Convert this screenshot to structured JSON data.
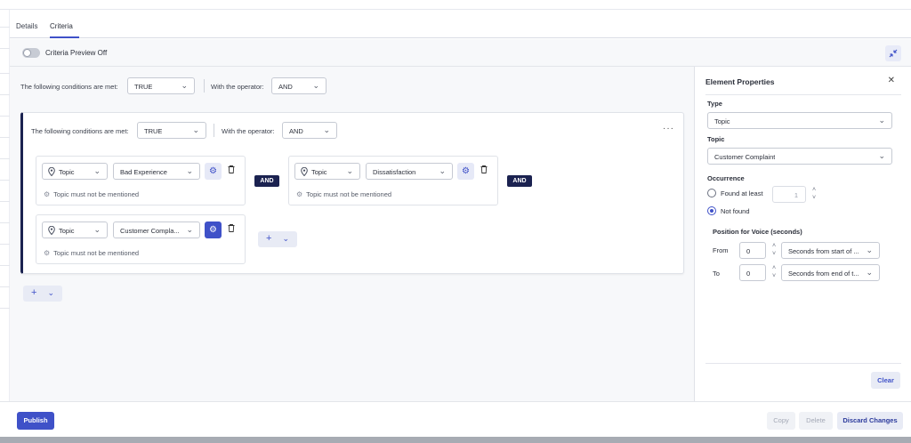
{
  "tabs": [
    {
      "label": "Details",
      "active": false
    },
    {
      "label": "Criteria",
      "active": true
    }
  ],
  "preview": {
    "label": "Criteria Preview Off",
    "on": false
  },
  "icons": {
    "collapse": "collapse-icon",
    "chevron": "chevron-down-icon",
    "pin": "map-pin-icon",
    "gear": "gear-icon",
    "trash": "trash-icon",
    "more": "more-horizontal-icon",
    "close": "close-icon",
    "plus": "plus-icon"
  },
  "root": {
    "conditions_label": "The following conditions are met:",
    "conditions_value": "TRUE",
    "operator_label": "With the operator:",
    "operator_value": "AND"
  },
  "group": {
    "conditions_label": "The following conditions are met:",
    "conditions_value": "TRUE",
    "operator_label": "With the operator:",
    "operator_value": "AND",
    "more": "···",
    "conditions": [
      {
        "type": "Topic",
        "value": "Bad Experience",
        "note": "Topic must not be mentioned",
        "active": false
      },
      {
        "type": "Topic",
        "value": "Dissatisfaction",
        "note": "Topic must not be mentioned",
        "active": false
      },
      {
        "type": "Topic",
        "value": "Customer Compla...",
        "note": "Topic must not be mentioned",
        "active": true
      }
    ],
    "and_label": "AND"
  },
  "add": {
    "plus": "+",
    "chevron": "⌄"
  },
  "panel": {
    "title": "Element Properties",
    "close": "✕",
    "type_label": "Type",
    "type_value": "Topic",
    "topic_label": "Topic",
    "topic_value": "Customer Complaint",
    "occurrence_label": "Occurrence",
    "found_at_least": "Found at least",
    "found_count": "1",
    "not_found": "Not found",
    "selected": "not_found",
    "voice_title": "Position for Voice (seconds)",
    "from_label": "From",
    "from_value": "0",
    "from_ref": "Seconds from start of ...",
    "to_label": "To",
    "to_value": "0",
    "to_ref": "Seconds from end of t...",
    "clear": "Clear"
  },
  "footer": {
    "publish": "Publish",
    "copy": "Copy",
    "delete": "Delete",
    "discard": "Discard Changes"
  },
  "colors": {
    "accent": "#3f51c8",
    "dark": "#1b2250",
    "panel_bg": "#f7f8fa"
  }
}
